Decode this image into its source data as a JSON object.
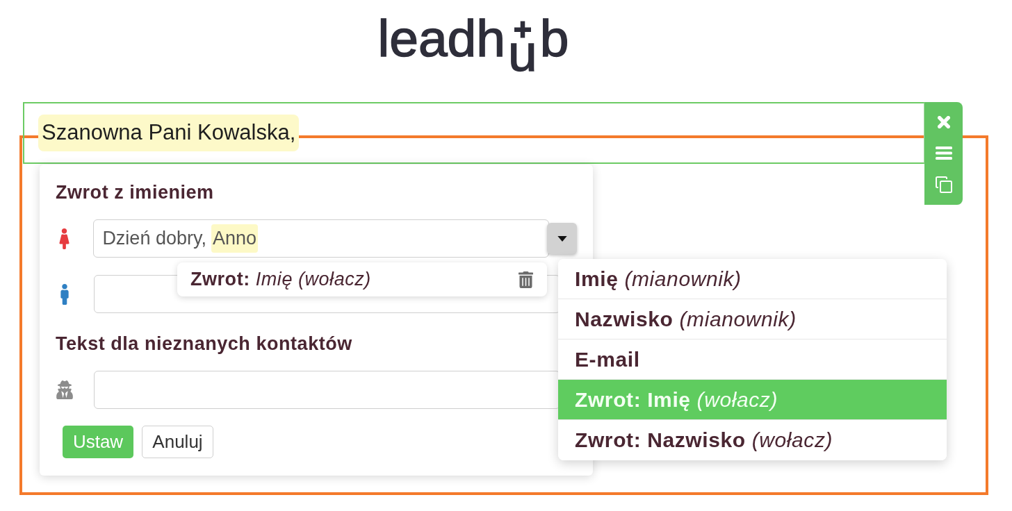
{
  "logo": {
    "parts": [
      {
        "kind": "plain",
        "text": "leadh"
      },
      {
        "kind": "plus_lowered",
        "text": "u"
      },
      {
        "kind": "plain",
        "text": "b"
      }
    ]
  },
  "editor": {
    "text": "Szanowna Pani Kowalska,",
    "highlighted": true
  },
  "popup": {
    "sections": [
      {
        "title": "Zwrot z imieniem",
        "fields": [
          {
            "kind": "female",
            "has_dropdown": true,
            "value": [
              {
                "kind": "text",
                "text": "Dzień dobry,"
              },
              {
                "kind": "token",
                "text": "Anno"
              }
            ],
            "token_info": {
              "text": "Zwrot: *Imię (wołacz)*"
            }
          },
          {
            "kind": "male",
            "has_dropdown": false
          }
        ]
      },
      {
        "title": "Tekst dla nieznanych kontaktów",
        "fields": [
          {
            "kind": "unknown",
            "has_dropdown": false
          }
        ]
      }
    ],
    "buttons": [
      {
        "kind": "primary",
        "label": "Ustaw"
      },
      {
        "kind": "secondary",
        "label": "Anuluj"
      }
    ]
  },
  "dropdown": {
    "items": [
      {
        "label": "Imię *(mianownik)*",
        "selected": false
      },
      {
        "label": "Nazwisko *(mianownik)*",
        "selected": false
      },
      {
        "label": "E-mail",
        "selected": false
      },
      {
        "label": "Zwrot: Imię *(wołacz)*",
        "selected": true
      },
      {
        "label": "Zwrot: Nazwisko *(wołacz)*",
        "selected": false
      }
    ]
  }
}
